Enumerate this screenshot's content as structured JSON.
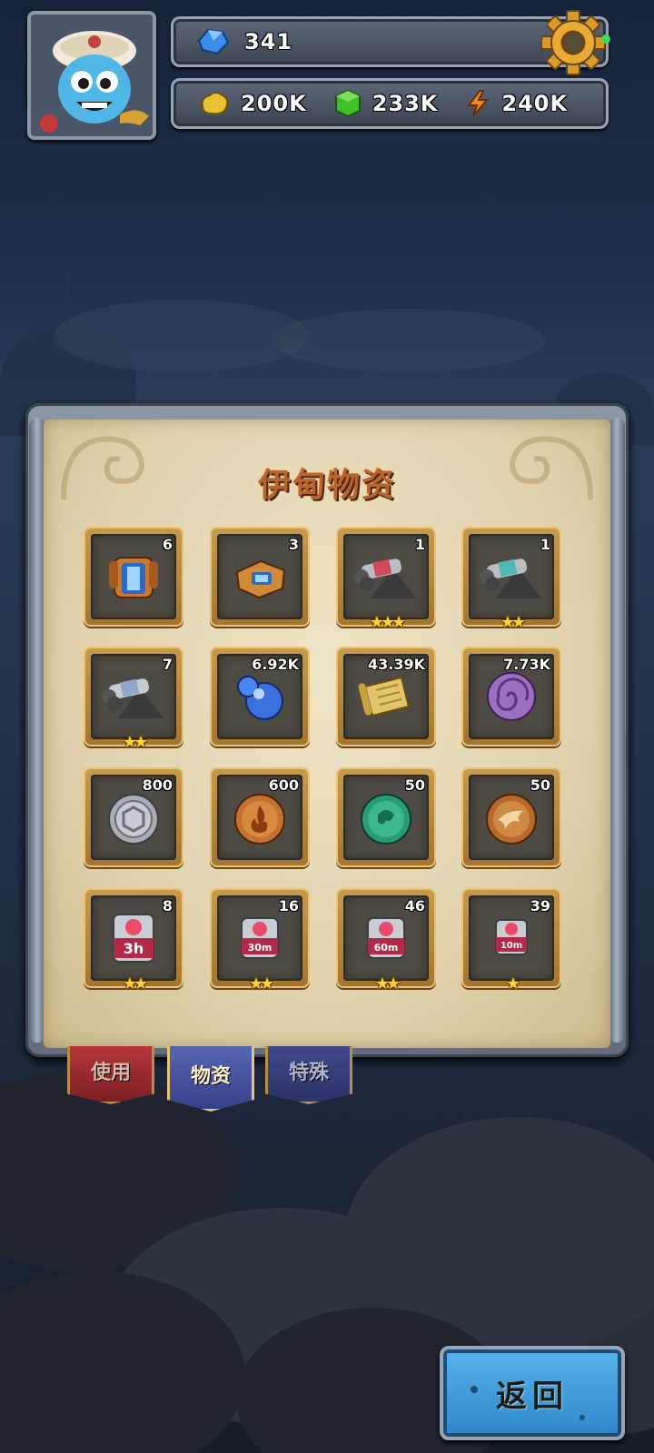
{
  "hud": {
    "avatar_icon": "genie-avatar-icon",
    "gems": "341",
    "gold": "200K",
    "elixir": "233K",
    "energy": "240K",
    "settings_icon": "gear-icon"
  },
  "panel": {
    "title": "伊甸物资"
  },
  "items": [
    {
      "icon": "armor-chest-icon",
      "count": "6",
      "stars": ""
    },
    {
      "icon": "armor-boots-icon",
      "count": "3",
      "stars": ""
    },
    {
      "icon": "cannon-red-icon",
      "count": "1",
      "stars": "★★★"
    },
    {
      "icon": "cannon-teal-icon",
      "count": "1",
      "stars": "★★"
    },
    {
      "icon": "cannon-silver-icon",
      "count": "7",
      "stars": "★★"
    },
    {
      "icon": "blue-orb-icon",
      "count": "6.92K",
      "stars": ""
    },
    {
      "icon": "scroll-icon",
      "count": "43.39K",
      "stars": ""
    },
    {
      "icon": "purple-shell-icon",
      "count": "7.73K",
      "stars": ""
    },
    {
      "icon": "silver-coin-icon",
      "count": "800",
      "stars": ""
    },
    {
      "icon": "bronze-flame-coin-icon",
      "count": "600",
      "stars": ""
    },
    {
      "icon": "green-coin-icon",
      "count": "50",
      "stars": ""
    },
    {
      "icon": "bronze-bird-coin-icon",
      "count": "50",
      "stars": ""
    },
    {
      "icon": "speedup-box-icon",
      "count": "8",
      "stars": "★★",
      "timer": "3h"
    },
    {
      "icon": "speedup-box-icon",
      "count": "16",
      "stars": "★★",
      "timer": "30m"
    },
    {
      "icon": "speedup-box-icon",
      "count": "46",
      "stars": "★★",
      "timer": "60m"
    },
    {
      "icon": "speedup-box-icon",
      "count": "39",
      "stars": "★",
      "timer": "10m"
    }
  ],
  "tabs": {
    "use": "使用",
    "materials": "物资",
    "special": "特殊"
  },
  "back_button": "返回",
  "colors": {
    "title": "#b8642a",
    "back_button": "#3a9be0",
    "slot_gold": "#c89a4c"
  }
}
